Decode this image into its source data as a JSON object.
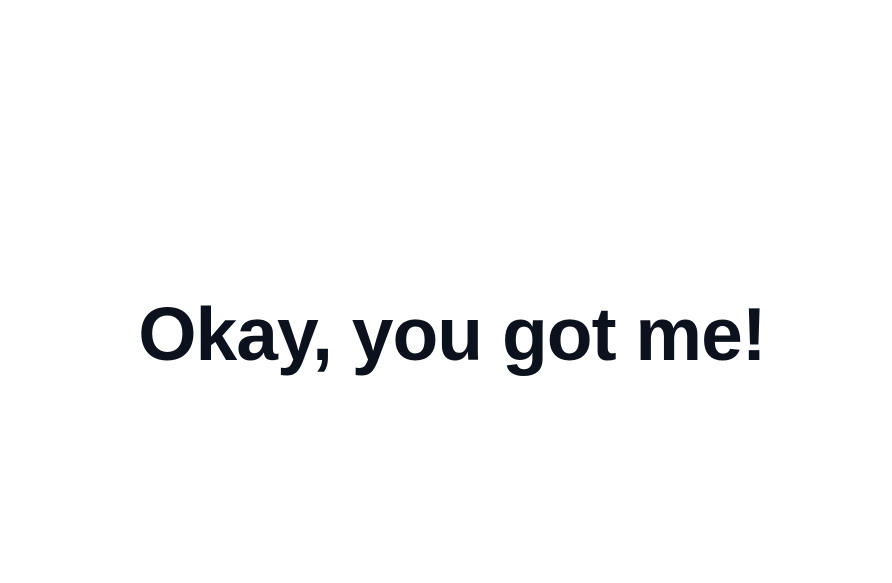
{
  "main": {
    "headline": "Okay, you got me!"
  },
  "colors": {
    "background": "#ffffff",
    "text": "#0b111d"
  }
}
